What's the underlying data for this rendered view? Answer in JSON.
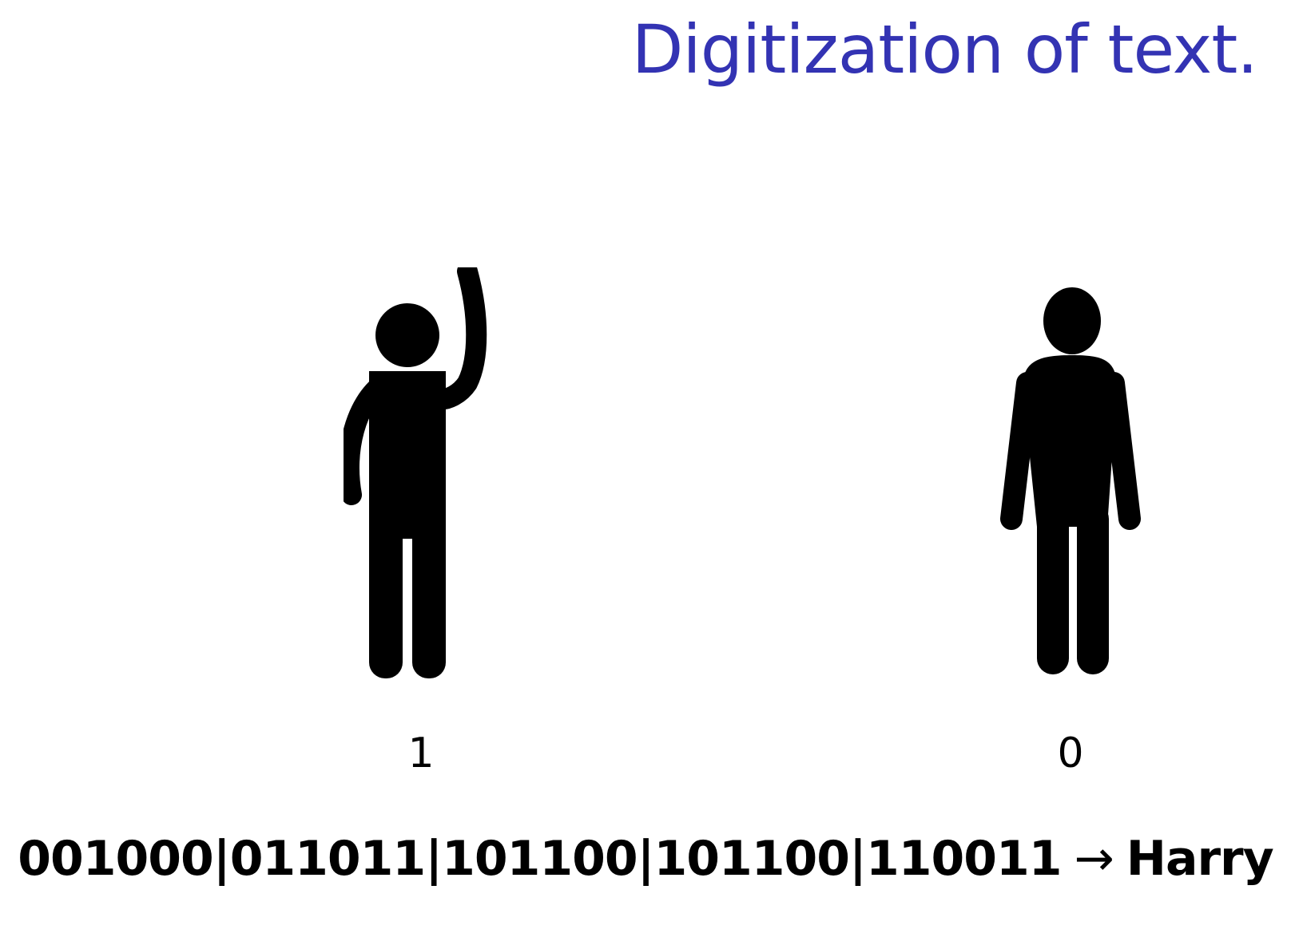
{
  "slide": {
    "title": "Digitization of text.",
    "title_color": "#3333b3"
  },
  "figures": [
    {
      "name": "person raising arm",
      "icon": "person-arm-raised-icon",
      "digit": "1"
    },
    {
      "name": "person standing",
      "icon": "person-standing-icon",
      "digit": "0"
    }
  ],
  "encoding": {
    "bits": [
      "001000",
      "011011",
      "101100",
      "101100",
      "110011"
    ],
    "separator": "|",
    "arrow": "→",
    "result": "Harry"
  }
}
